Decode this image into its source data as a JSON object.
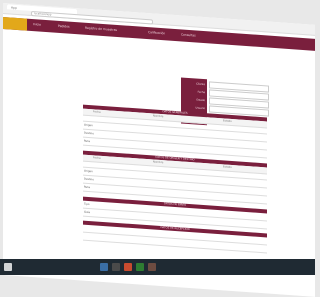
{
  "browser": {
    "tab_title": "App",
    "address": "localhost/app"
  },
  "nav": {
    "items": [
      "Inicio",
      "Pedidos",
      "Registro de muestras",
      "Calificación",
      "Consultas"
    ]
  },
  "side": {
    "labels": [
      "Cliente",
      "Fecha",
      "Estado",
      "Usuario"
    ],
    "values": [
      "",
      "",
      "",
      ""
    ]
  },
  "sections": [
    {
      "title": "DATOS GENERALES"
    },
    {
      "title": "DATOS DE ORIGEN Y DESTINO"
    },
    {
      "title": "DATOS DE ENVÍO"
    },
    {
      "title": "DATOS DE RECEPCIÓN"
    }
  ],
  "table1": {
    "headers": [
      "Fecha",
      "Nombre",
      "Estado"
    ],
    "row": [
      "",
      "",
      ""
    ]
  },
  "fields1": [
    {
      "label": "Origen",
      "value": ""
    },
    {
      "label": "Destino",
      "value": ""
    },
    {
      "label": "Ruta",
      "value": ""
    }
  ],
  "table2": {
    "headers": [
      "Fecha",
      "Nombre",
      "Estado"
    ],
    "row": [
      "",
      "",
      ""
    ]
  },
  "fields2": [
    {
      "label": "Origen",
      "value": ""
    },
    {
      "label": "Destino",
      "value": ""
    },
    {
      "label": "Ruta",
      "value": ""
    }
  ],
  "fields3": [
    {
      "label": "Tipo",
      "value": ""
    },
    {
      "label": "Guía",
      "value": ""
    }
  ],
  "taskbar": {
    "time": ""
  },
  "colors": {
    "primary": "#7a1f3d",
    "accent": "#e2a81a"
  }
}
